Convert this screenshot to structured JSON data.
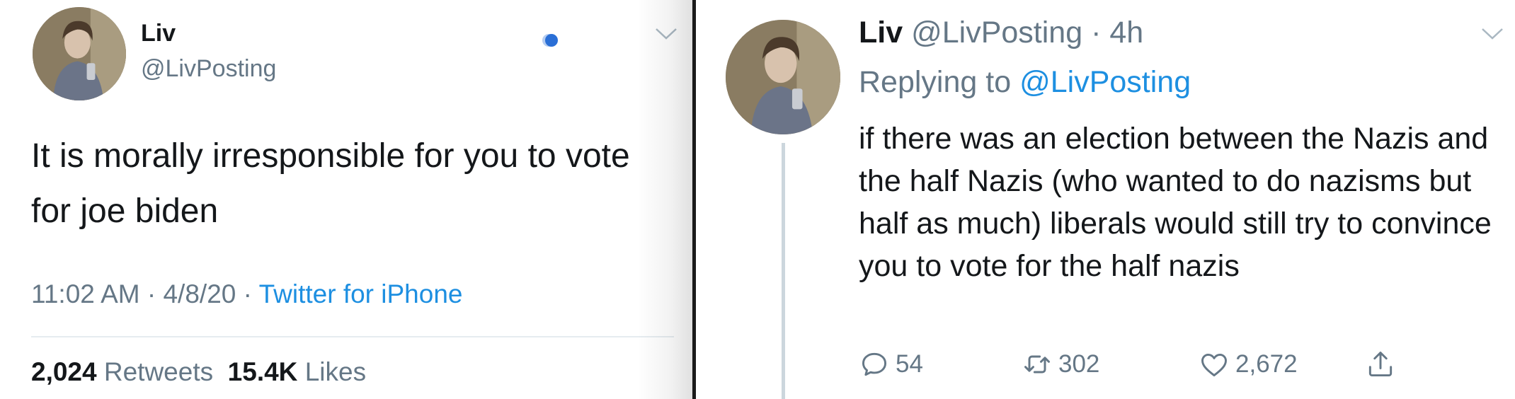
{
  "left_tweet": {
    "name": "Liv",
    "handle": "@LivPosting",
    "text": "It is morally irresponsible for you to vote for joe biden",
    "time": "11:02 AM",
    "date": "4/8/20",
    "source": "Twitter for iPhone",
    "separator": " · ",
    "retweets_count": "2,024",
    "retweets_label": "Retweets",
    "likes_count": "15.4K",
    "likes_label": "Likes"
  },
  "right_tweet": {
    "name": "Liv",
    "handle": "@LivPosting",
    "separator": " · ",
    "age": "4h",
    "replying_prefix": "Replying to",
    "replying_to": "@LivPosting",
    "text": "if there was an election between the Nazis and the half Nazis (who wanted to do nazisms but half as much) liberals would still try to convince you to vote for the half nazis",
    "reply_count": "54",
    "retweet_count": "302",
    "like_count": "2,672"
  },
  "icons": {
    "chevron": "chevron-down-icon",
    "reply": "reply-icon",
    "retweet": "retweet-icon",
    "like": "heart-icon",
    "share": "share-icon"
  },
  "colors": {
    "text": "#14171a",
    "muted": "#657786",
    "link": "#1d8fe1",
    "divider": "#1a1a1a",
    "thread_line": "#ccd6dd"
  }
}
